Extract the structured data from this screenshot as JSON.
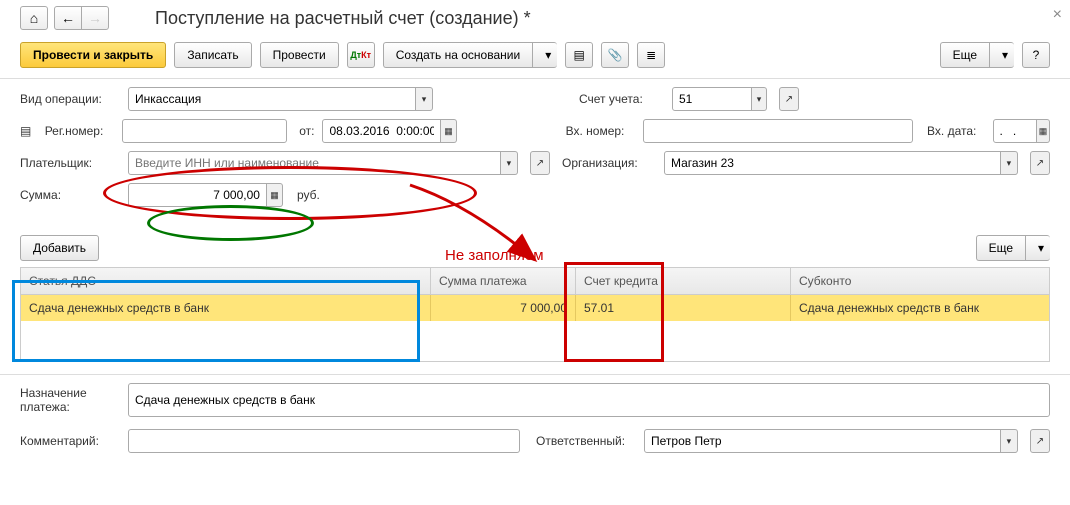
{
  "title": "Поступление на расчетный счет (создание) *",
  "toolbar": {
    "post_and_close": "Провести и закрыть",
    "save": "Записать",
    "post": "Провести",
    "create_based": "Создать на основании",
    "more": "Еще"
  },
  "fields": {
    "op_type_label": "Вид операции:",
    "op_type_value": "Инкассация",
    "account_label": "Счет учета:",
    "account_value": "51",
    "reg_num_label": "Рег.номер:",
    "reg_num_value": "",
    "date_from_label": "от:",
    "date_value": "08.03.2016  0:00:00",
    "in_num_label": "Вх. номер:",
    "in_num_value": "",
    "in_date_label": "Вх. дата:",
    "in_date_value": ".   .",
    "payer_label": "Плательщик:",
    "payer_placeholder": "Введите ИНН или наименование",
    "org_label": "Организация:",
    "org_value": "Магазин 23",
    "sum_label": "Сумма:",
    "sum_value": "7 000,00",
    "sum_currency": "руб.",
    "purpose_label": "Назначение\nплатежа:",
    "purpose_value": "Сдача денежных средств в банк",
    "comment_label": "Комментарий:",
    "comment_value": "",
    "responsible_label": "Ответственный:",
    "responsible_value": "Петров Петр"
  },
  "table": {
    "add_btn": "Добавить",
    "more_btn": "Еще",
    "headers": [
      "Статья ДДС",
      "Сумма платежа",
      "Счет кредита",
      "Субконто"
    ],
    "row": {
      "article": "Сдача денежных средств в банк",
      "sum": "7 000,00",
      "credit_account": "57.01",
      "subkonto": "Сдача денежных средств в банк"
    }
  },
  "annotations": {
    "not_fill": "Не заполняем"
  }
}
